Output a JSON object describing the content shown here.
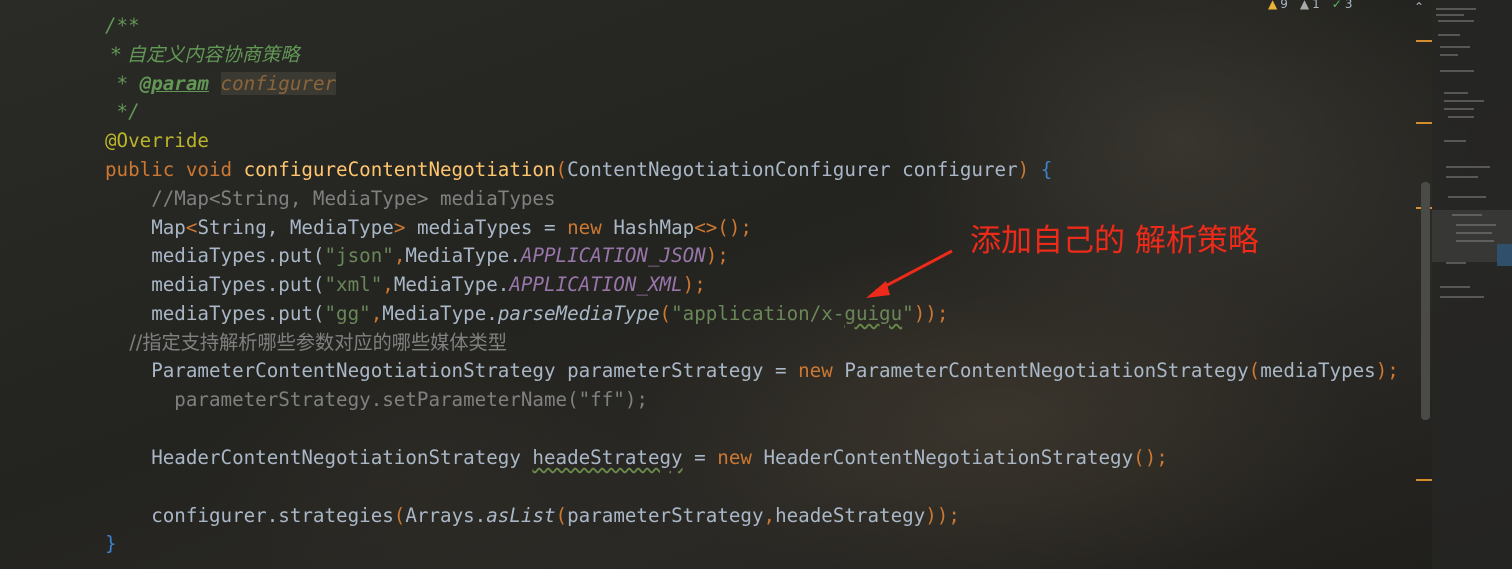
{
  "status": {
    "warnings": "9",
    "weak_warnings": "1",
    "typos": "3",
    "chevron": "⌃"
  },
  "code": {
    "l1": "/**",
    "l2": " * 自定义内容协商策略",
    "l3_prefix": " * ",
    "l3_tag": "@param",
    "l3_sp": " ",
    "l3_param": "configurer",
    "l4": " */",
    "l5": "@Override",
    "l6_kw": "public void ",
    "l6_fn": "configureContentNegotiation",
    "l6_p1": "(",
    "l6_args": "ContentNegotiationConfigurer configurer",
    "l6_p2": ") ",
    "l6_brace": "{",
    "l7": "    //Map<String, MediaType> mediaTypes",
    "l8_a": "    Map",
    "l8_b": "<",
    "l8_c": "String, MediaType",
    "l8_d": ">",
    "l8_e": " mediaTypes = ",
    "l8_kw": "new",
    "l8_f": " HashMap",
    "l8_g": "<>();",
    "l9_a": "    mediaTypes.put(",
    "l9_str": "\"json\"",
    "l9_comma": ",",
    "l9_b": "MediaType.",
    "l9_const": "APPLICATION_JSON",
    "l9_end": ");",
    "l10_a": "    mediaTypes.put(",
    "l10_str": "\"xml\"",
    "l10_comma": ",",
    "l10_b": "MediaType.",
    "l10_const": "APPLICATION_XML",
    "l10_end": ");",
    "l11_a": "    mediaTypes.put(",
    "l11_str": "\"gg\"",
    "l11_comma": ",",
    "l11_b": "MediaType.",
    "l11_static": "parseMediaType",
    "l11_p": "(",
    "l11_str2a": "\"application/x-",
    "l11_str2b": "guigu",
    "l11_str2c": "\"",
    "l11_end": "));",
    "l12": "    //指定支持解析哪些参数对应的哪些媒体类型",
    "l13_a": "    ParameterContentNegotiationStrategy parameterStrategy = ",
    "l13_kw": "new",
    "l13_b": " ParameterContentNegotiationStrategy",
    "l13_p": "(",
    "l13_c": "mediaTypes",
    "l13_end": ");",
    "l14": "      parameterStrategy.setParameterName(\"ff\");",
    "l16_a": "    HeaderContentNegotiationStrategy ",
    "l16_var": "headeStrategy",
    "l16_b": " = ",
    "l16_kw": "new",
    "l16_c": " HeaderContentNegotiationStrategy",
    "l16_end": "();",
    "l18_a": "    configurer.strategies",
    "l18_p": "(",
    "l18_b": "Arrays.",
    "l18_static": "asList",
    "l18_p2": "(",
    "l18_c": "parameterStrategy",
    "l18_comma": ",",
    "l18_d": "headeStrategy",
    "l18_end": "));",
    "l19": "}"
  },
  "annotation": {
    "text": "添加自己的 解析策略",
    "color": "#ee2a1a"
  }
}
